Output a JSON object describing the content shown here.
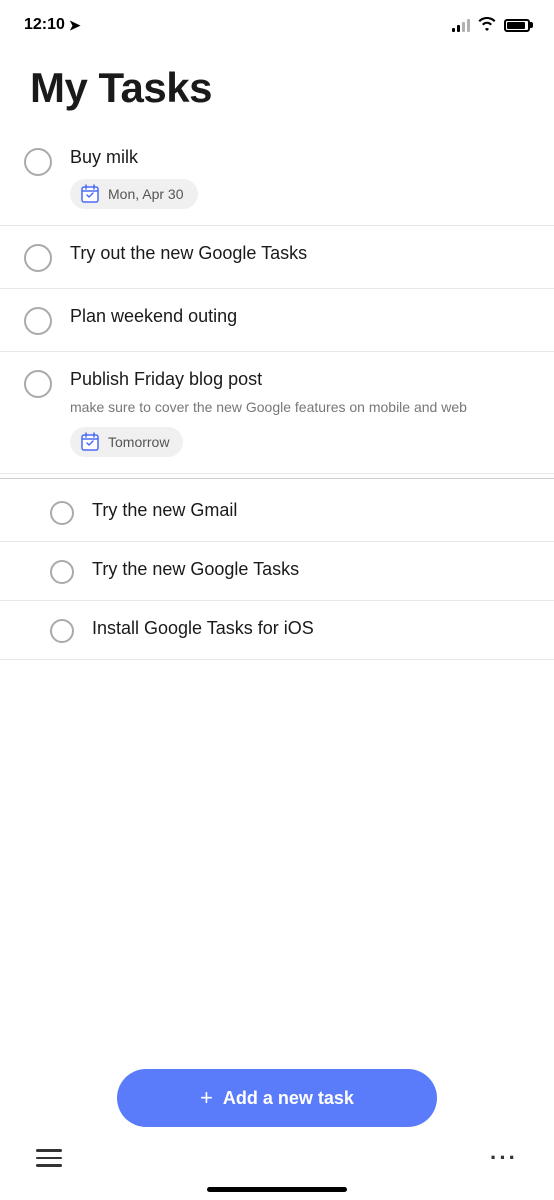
{
  "statusBar": {
    "time": "12:10",
    "hasLocation": true
  },
  "page": {
    "title": "My Tasks"
  },
  "tasks": [
    {
      "id": "buy-milk",
      "title": "Buy milk",
      "notes": null,
      "date": "Mon, Apr 30",
      "hasDate": true,
      "indented": false
    },
    {
      "id": "try-google-tasks",
      "title": "Try out the new Google Tasks",
      "notes": null,
      "date": null,
      "hasDate": false,
      "indented": false
    },
    {
      "id": "plan-weekend",
      "title": "Plan weekend outing",
      "notes": null,
      "date": null,
      "hasDate": false,
      "indented": false
    },
    {
      "id": "publish-blog",
      "title": "Publish Friday blog post",
      "notes": "make sure to cover the new Google features on mobile and web",
      "date": "Tomorrow",
      "hasDate": true,
      "indented": false
    }
  ],
  "subTasks": [
    {
      "id": "try-gmail",
      "title": "Try the new Gmail",
      "indented": true
    },
    {
      "id": "try-google-tasks-2",
      "title": "Try the new Google Tasks",
      "indented": true
    },
    {
      "id": "install-ios",
      "title": "Install Google Tasks for iOS",
      "indented": true
    }
  ],
  "bottomNav": {
    "addTaskLabel": "Add a new task",
    "addTaskPlus": "+"
  }
}
